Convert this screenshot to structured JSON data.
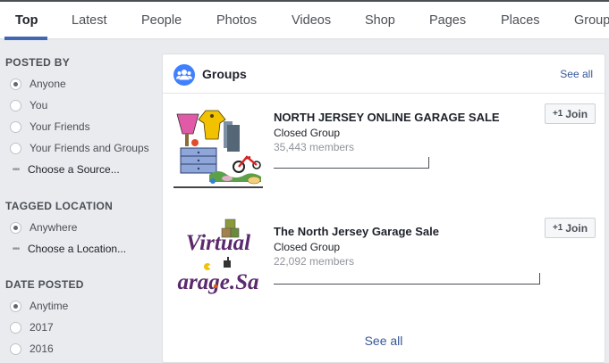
{
  "tabs": [
    "Top",
    "Latest",
    "People",
    "Photos",
    "Videos",
    "Shop",
    "Pages",
    "Places",
    "Group"
  ],
  "sidebar": {
    "posted_by": {
      "title": "POSTED BY",
      "options": [
        "Anyone",
        "You",
        "Your Friends",
        "Your Friends and Groups"
      ],
      "selected": "Anyone",
      "choose": "Choose a Source..."
    },
    "tagged_location": {
      "title": "TAGGED LOCATION",
      "options": [
        "Anywhere"
      ],
      "selected": "Anywhere",
      "choose": "Choose a Location..."
    },
    "date_posted": {
      "title": "DATE POSTED",
      "options": [
        "Anytime",
        "2017",
        "2016"
      ],
      "selected": "Anytime"
    }
  },
  "groups_card": {
    "title": "Groups",
    "see_all_top": "See all",
    "see_all_bottom": "See all",
    "join_label": "Join",
    "join_icon": "+1",
    "items": [
      {
        "name": "NORTH JERSEY ONLINE GARAGE SALE",
        "type": "Closed Group",
        "members": "35,443 members"
      },
      {
        "name": "The North Jersey Garage Sale",
        "type": "Closed Group",
        "members": "22,092 members",
        "image_text_1": "Virtual",
        "image_text_2": "arage.Sa"
      }
    ]
  },
  "colors": {
    "accent": "#4267b2",
    "link": "#365899",
    "groups_icon": "#4080ff",
    "image_text": "#5b2a6e"
  }
}
